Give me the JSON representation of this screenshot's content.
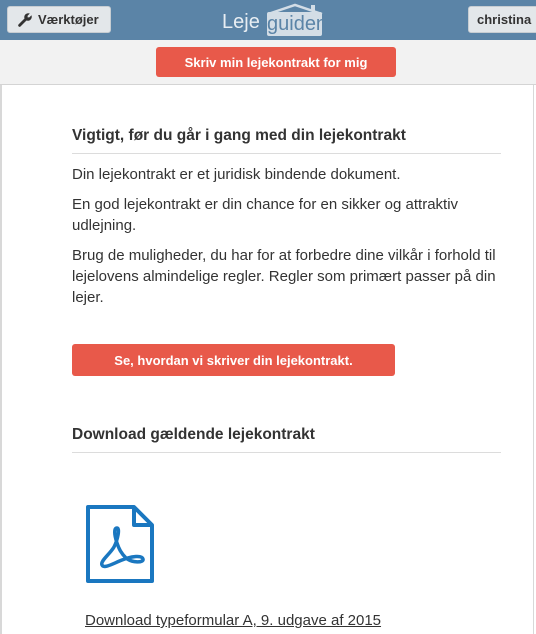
{
  "header": {
    "tools_label": "Værktøjer",
    "user_label": "christina",
    "logo": {
      "part1": "Leje",
      "part2": "guiden"
    }
  },
  "cta_top": {
    "label": "Skriv min lejekontrakt for mig"
  },
  "section1": {
    "title": "Vigtigt, før du går i gang med din lejekontrakt",
    "paragraphs": [
      "Din lejekontrakt er et juridisk bindende dokument.",
      "En god lejekontrakt er din chance for en sikker og attraktiv udlejning.",
      "Brug de muligheder, du har for at forbedre dine vilkår i forhold til lejelovens almindelige regler. Regler som primært passer på din lejer."
    ]
  },
  "cta_mid": {
    "label": "Se, hvordan vi skriver din lejekontrakt."
  },
  "section2": {
    "title": "Download gældende lejekontrakt",
    "download_link": "Download typeformular A, 9. udgave af 2015"
  },
  "colors": {
    "header_bg": "#5b84a7",
    "accent_red": "#e8594a",
    "pdf_blue": "#1a77c0"
  },
  "icons": {
    "tools": "wrench-icon",
    "pdf": "pdf-file-icon"
  }
}
